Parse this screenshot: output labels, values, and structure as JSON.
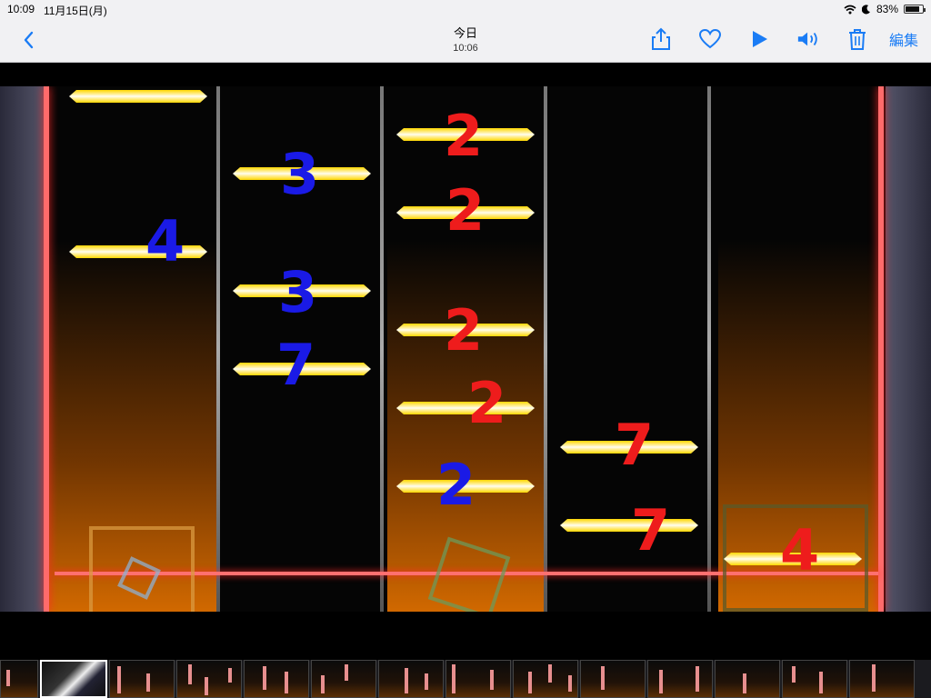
{
  "status_bar": {
    "time": "10:09",
    "date": "11月15日(月)",
    "battery": "83%",
    "battery_level": 0.83
  },
  "nav": {
    "title": "今日",
    "subtitle": "10:06",
    "edit_label": "編集"
  },
  "annotations": {
    "blue": [
      "4",
      "3",
      "3",
      "7",
      "2"
    ],
    "red": [
      "2",
      "2",
      "2",
      "2",
      "7",
      "7",
      "4"
    ]
  },
  "colors": {
    "accent": "#1a7cf5",
    "blue_mark": "#1a1ae6",
    "red_mark": "#ee1c1c",
    "note": "#ffd700",
    "rail": "#ff6b6b"
  },
  "icons": [
    "chevron-left-icon",
    "share-icon",
    "heart-icon",
    "play-icon",
    "speaker-icon",
    "trash-icon",
    "wifi-icon",
    "moon-icon",
    "battery-icon"
  ]
}
